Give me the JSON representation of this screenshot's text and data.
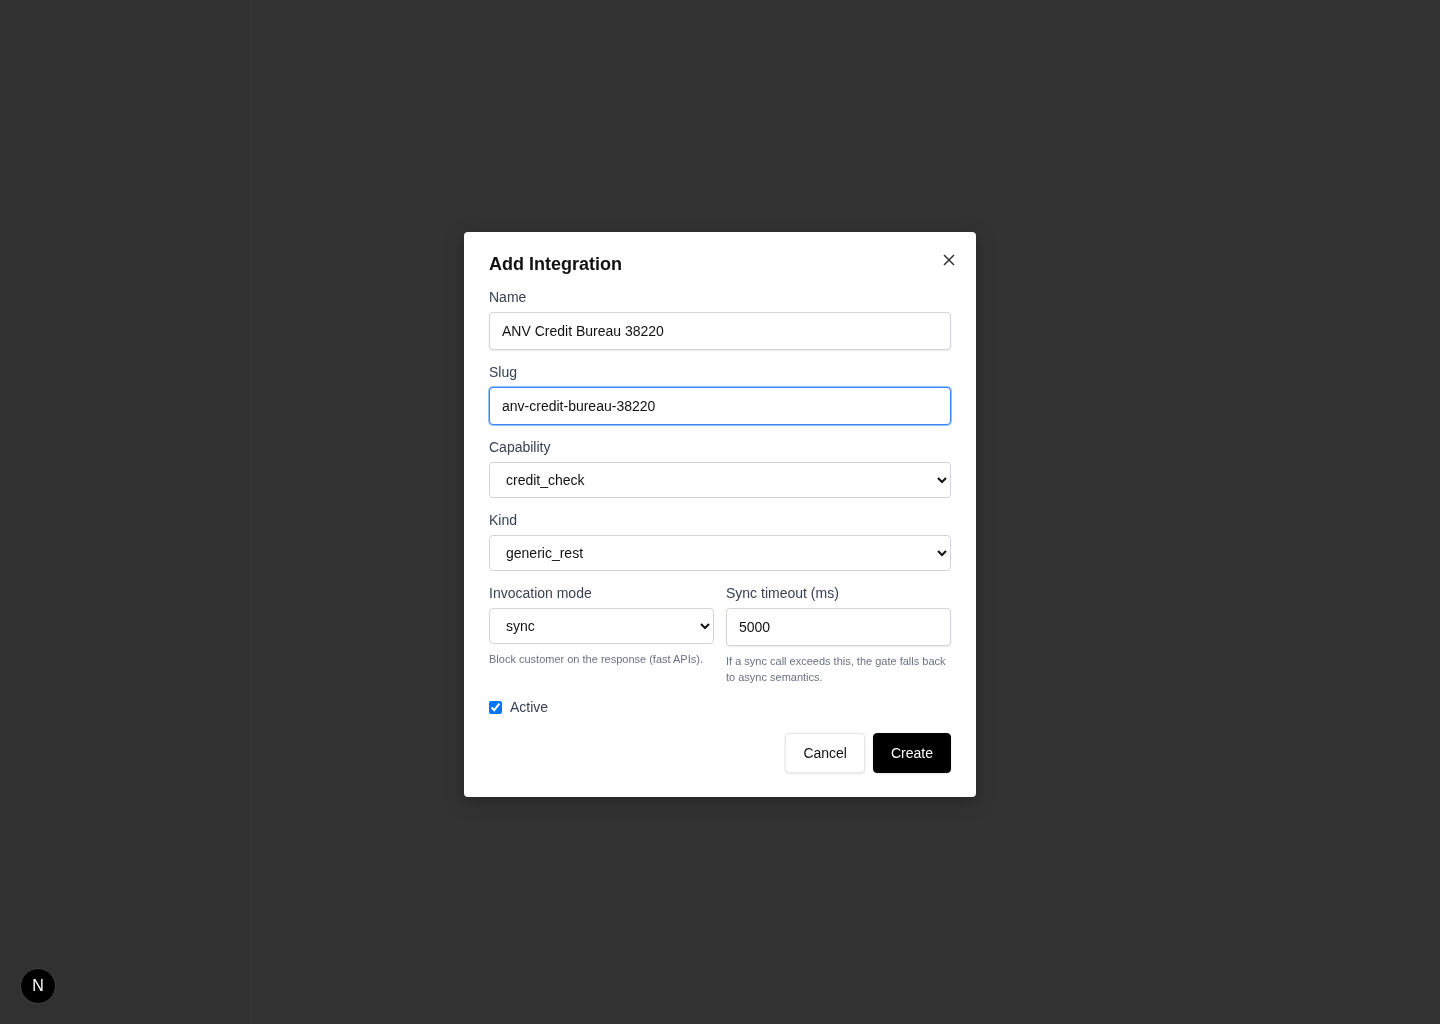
{
  "dialog": {
    "title": "Add Integration",
    "fields": [
      {
        "kind": "text",
        "label": "Name",
        "value": "ANV Credit Bureau 38220",
        "focused": false
      },
      {
        "kind": "text",
        "label": "Slug",
        "value": "anv-credit-bureau-38220",
        "focused": true
      },
      {
        "kind": "select",
        "label": "Capability",
        "value": "credit_check"
      },
      {
        "kind": "select",
        "label": "Kind",
        "value": "generic_rest"
      }
    ],
    "columns": [
      {
        "kind": "select",
        "label": "Invocation mode",
        "value": "sync",
        "help": "Block customer on the response (fast APIs)."
      },
      {
        "kind": "text",
        "label": "Sync timeout (ms)",
        "value": "5000",
        "help": "If a sync call exceeds this, the gate falls back to async semantics."
      }
    ],
    "active": {
      "label": "Active",
      "checked": true
    },
    "buttons": [
      {
        "kind": "secondary",
        "label": "Cancel"
      },
      {
        "kind": "primary",
        "label": "Create"
      }
    ]
  },
  "dev_badge": {
    "label": "N"
  }
}
